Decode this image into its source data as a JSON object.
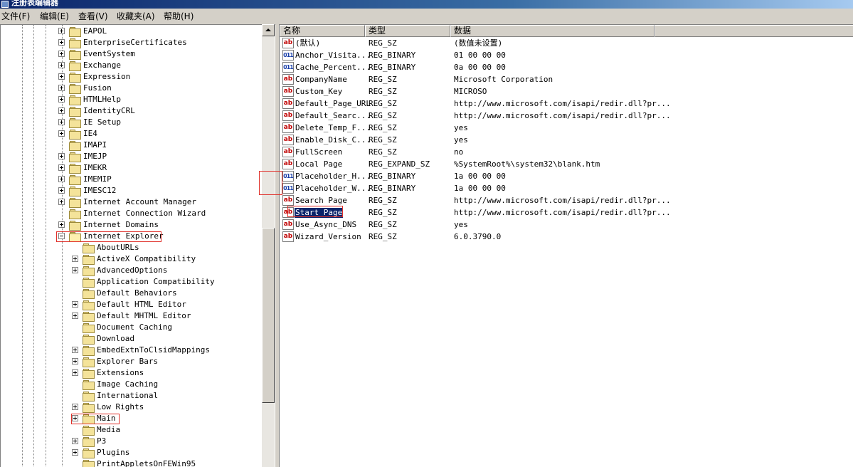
{
  "window": {
    "title": "注册表编辑器"
  },
  "menu": [
    {
      "label": "文件(F)"
    },
    {
      "label": "编辑(E)"
    },
    {
      "label": "查看(V)"
    },
    {
      "label": "收藏夹(A)"
    },
    {
      "label": "帮助(H)"
    }
  ],
  "tree": {
    "items": [
      {
        "label": "EAPOL",
        "expander": "plus",
        "level": 0
      },
      {
        "label": "EnterpriseCertificates",
        "expander": "plus",
        "level": 0
      },
      {
        "label": "EventSystem",
        "expander": "plus",
        "level": 0
      },
      {
        "label": "Exchange",
        "expander": "plus",
        "level": 0
      },
      {
        "label": "Expression",
        "expander": "plus",
        "level": 0
      },
      {
        "label": "Fusion",
        "expander": "plus",
        "level": 0
      },
      {
        "label": "HTMLHelp",
        "expander": "plus",
        "level": 0
      },
      {
        "label": "IdentityCRL",
        "expander": "plus",
        "level": 0
      },
      {
        "label": "IE Setup",
        "expander": "plus",
        "level": 0
      },
      {
        "label": "IE4",
        "expander": "plus",
        "level": 0
      },
      {
        "label": "IMAPI",
        "expander": "none",
        "level": 0
      },
      {
        "label": "IMEJP",
        "expander": "plus",
        "level": 0
      },
      {
        "label": "IMEKR",
        "expander": "plus",
        "level": 0
      },
      {
        "label": "IMEMIP",
        "expander": "plus",
        "level": 0
      },
      {
        "label": "IMESC12",
        "expander": "plus",
        "level": 0
      },
      {
        "label": "Internet Account Manager",
        "expander": "plus",
        "level": 0
      },
      {
        "label": "Internet Connection Wizard",
        "expander": "none",
        "level": 0
      },
      {
        "label": "Internet Domains",
        "expander": "plus",
        "level": 0
      },
      {
        "label": "Internet Explorer",
        "expander": "minus",
        "level": 0,
        "open": true
      },
      {
        "label": "AboutURLs",
        "expander": "none",
        "level": 1
      },
      {
        "label": "ActiveX Compatibility",
        "expander": "plus",
        "level": 1
      },
      {
        "label": "AdvancedOptions",
        "expander": "plus",
        "level": 1
      },
      {
        "label": "Application Compatibility",
        "expander": "none",
        "level": 1
      },
      {
        "label": "Default Behaviors",
        "expander": "none",
        "level": 1
      },
      {
        "label": "Default HTML Editor",
        "expander": "plus",
        "level": 1
      },
      {
        "label": "Default MHTML Editor",
        "expander": "plus",
        "level": 1
      },
      {
        "label": "Document Caching",
        "expander": "none",
        "level": 1
      },
      {
        "label": "Download",
        "expander": "none",
        "level": 1
      },
      {
        "label": "EmbedExtnToClsidMappings",
        "expander": "plus",
        "level": 1
      },
      {
        "label": "Explorer Bars",
        "expander": "plus",
        "level": 1
      },
      {
        "label": "Extensions",
        "expander": "plus",
        "level": 1
      },
      {
        "label": "Image Caching",
        "expander": "none",
        "level": 1
      },
      {
        "label": "International",
        "expander": "none",
        "level": 1
      },
      {
        "label": "Low Rights",
        "expander": "plus",
        "level": 1
      },
      {
        "label": "Main",
        "expander": "plus",
        "level": 1
      },
      {
        "label": "Media",
        "expander": "none",
        "level": 1
      },
      {
        "label": "P3",
        "expander": "plus",
        "level": 1
      },
      {
        "label": "Plugins",
        "expander": "plus",
        "level": 1
      },
      {
        "label": "PrintAppletsOnFEWin95",
        "expander": "none",
        "level": 1
      }
    ]
  },
  "list": {
    "columns": [
      {
        "label": "名称"
      },
      {
        "label": "类型"
      },
      {
        "label": "数据"
      }
    ],
    "rows": [
      {
        "name": "(默认)",
        "type": "REG_SZ",
        "data": "(数值未设置)",
        "icon": "string-value-icon"
      },
      {
        "name": "Anchor_Visita...",
        "type": "REG_BINARY",
        "data": "01 00 00 00",
        "icon": "binary-value-icon"
      },
      {
        "name": "Cache_Percent...",
        "type": "REG_BINARY",
        "data": "0a 00 00 00",
        "icon": "binary-value-icon"
      },
      {
        "name": "CompanyName",
        "type": "REG_SZ",
        "data": "Microsoft Corporation",
        "icon": "string-value-icon"
      },
      {
        "name": "Custom_Key",
        "type": "REG_SZ",
        "data": "MICROSO",
        "icon": "string-value-icon"
      },
      {
        "name": "Default_Page_URL",
        "type": "REG_SZ",
        "data": "http://www.microsoft.com/isapi/redir.dll?pr...",
        "icon": "string-value-icon"
      },
      {
        "name": "Default_Searc...",
        "type": "REG_SZ",
        "data": "http://www.microsoft.com/isapi/redir.dll?pr...",
        "icon": "string-value-icon"
      },
      {
        "name": "Delete_Temp_F...",
        "type": "REG_SZ",
        "data": "yes",
        "icon": "string-value-icon"
      },
      {
        "name": "Enable_Disk_C...",
        "type": "REG_SZ",
        "data": "yes",
        "icon": "string-value-icon"
      },
      {
        "name": "FullScreen",
        "type": "REG_SZ",
        "data": "no",
        "icon": "string-value-icon"
      },
      {
        "name": "Local Page",
        "type": "REG_EXPAND_SZ",
        "data": "%SystemRoot%\\system32\\blank.htm",
        "icon": "string-value-icon"
      },
      {
        "name": "Placeholder_H...",
        "type": "REG_BINARY",
        "data": "1a 00 00 00",
        "icon": "binary-value-icon"
      },
      {
        "name": "Placeholder_W...",
        "type": "REG_BINARY",
        "data": "1a 00 00 00",
        "icon": "binary-value-icon"
      },
      {
        "name": "Search Page",
        "type": "REG_SZ",
        "data": "http://www.microsoft.com/isapi/redir.dll?pr...",
        "icon": "string-value-icon"
      },
      {
        "name": "Start Page",
        "type": "REG_SZ",
        "data": "http://www.microsoft.com/isapi/redir.dll?pr...",
        "icon": "string-value-icon",
        "selected": true
      },
      {
        "name": "Use_Async_DNS",
        "type": "REG_SZ",
        "data": "yes",
        "icon": "string-value-icon"
      },
      {
        "name": "Wizard_Version",
        "type": "REG_SZ",
        "data": "6.0.3790.0",
        "icon": "string-value-icon"
      }
    ]
  },
  "icons": {
    "sz_glyph": "ab",
    "bin_glyph": "011"
  },
  "colors": {
    "selection": "#0a246a",
    "annotation": "#e0302a",
    "title_bar": "#0a246a"
  }
}
